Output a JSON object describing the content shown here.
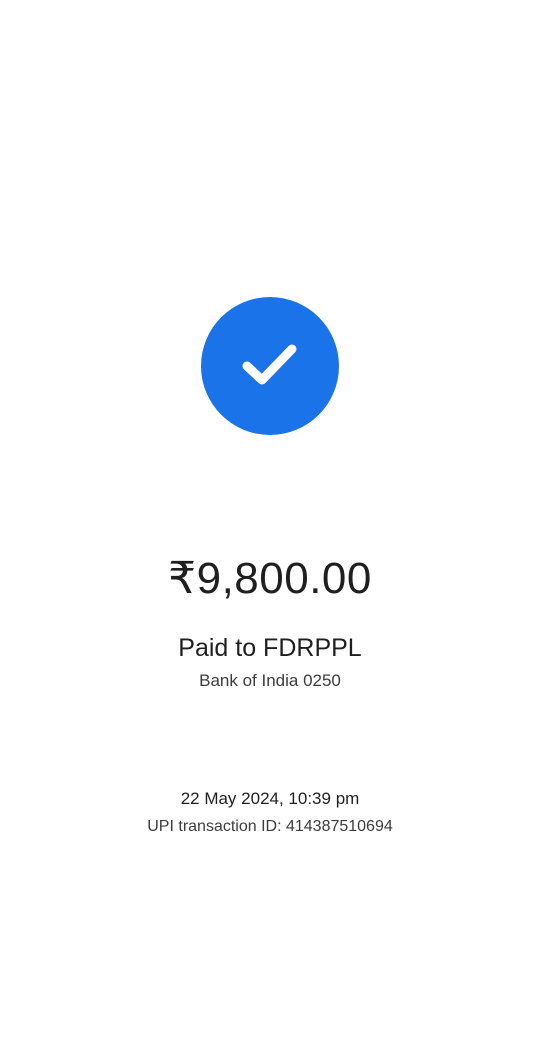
{
  "status": {
    "icon": "checkmark-icon",
    "badge_color": "#1a73e8",
    "check_color": "#ffffff"
  },
  "payment": {
    "amount": "₹9,800.00",
    "paid_to": "Paid to FDRPPL",
    "bank": "Bank of India 0250"
  },
  "transaction": {
    "datetime": "22 May 2024, 10:39 pm",
    "upi_id_line": "UPI transaction ID: 414387510694"
  }
}
